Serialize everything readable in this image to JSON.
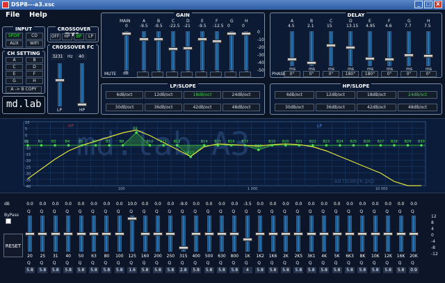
{
  "window": {
    "title": "DSP8---a3.xsc",
    "minimize": "_",
    "maximize": "□",
    "close": "X"
  },
  "menu": [
    {
      "label": "File"
    },
    {
      "label": "Help"
    }
  ],
  "input": {
    "title": "INPUT",
    "buttons": [
      {
        "label": "SPDIF",
        "active": true
      },
      {
        "label": "CD",
        "active": false
      },
      {
        "label": "AUX",
        "active": false
      },
      {
        "label": "WIFI",
        "active": false
      }
    ]
  },
  "ch_setting": {
    "title": "CH SETTING",
    "channels": [
      "A",
      "B",
      "C",
      "D",
      "E",
      "F",
      "G",
      "H"
    ],
    "copy": "A -> B COPY"
  },
  "brand": {
    "logo": "md.lab"
  },
  "crossover_type": {
    "title": "CROSSOVER TYPE",
    "buttons": [
      {
        "label": "OFF",
        "active": false
      },
      {
        "label": "HP",
        "active": false
      },
      {
        "label": "BP",
        "active": true
      },
      {
        "label": "LP",
        "active": false
      }
    ]
  },
  "crossover_fc": {
    "title": "CROSSOVER FC",
    "lp_value": "3231",
    "unit": "Hz",
    "hp_value": "40",
    "lp_label": "LP",
    "hp_label": "HP",
    "lp_level": 0.62,
    "hp_level": 0.05
  },
  "gain": {
    "title": "GAIN",
    "main_label": "MAIN",
    "main_value": "0",
    "main_level": 0.95,
    "channels": [
      {
        "name": "A",
        "value": "-9.5",
        "level": 0.8
      },
      {
        "name": "B",
        "value": "-9.5",
        "level": 0.8
      },
      {
        "name": "C",
        "value": "-22.5",
        "level": 0.55
      },
      {
        "name": "D",
        "value": "-21",
        "level": 0.58
      },
      {
        "name": "E",
        "value": "-9.5",
        "level": 0.8
      },
      {
        "name": "F",
        "value": "-12.5",
        "level": 0.75
      },
      {
        "name": "G",
        "value": "0",
        "level": 0.95
      },
      {
        "name": "H",
        "value": "0",
        "level": 0.95
      }
    ],
    "scale": [
      "0",
      "-10",
      "-20",
      "-30",
      "-40",
      "-50"
    ],
    "unit": "dB",
    "mute_label": "MUTE"
  },
  "delay": {
    "title": "DELAY",
    "channels": [
      {
        "name": "A",
        "value": "4.5",
        "unit": "ms",
        "phase": "0°",
        "level": 0.2
      },
      {
        "name": "B",
        "value": "2.1",
        "unit": "ms",
        "phase": "0°",
        "level": 0.1
      },
      {
        "name": "C",
        "value": "15",
        "unit": "ms",
        "phase": "0°",
        "level": 0.6
      },
      {
        "name": "D",
        "value": "13.15",
        "unit": "ms",
        "phase": "180°",
        "level": 0.55
      },
      {
        "name": "E",
        "value": "4.95",
        "unit": "ms",
        "phase": "180°",
        "level": 0.22
      },
      {
        "name": "F",
        "value": "4.6",
        "unit": "ms",
        "phase": "0°",
        "level": 0.2
      },
      {
        "name": "G",
        "value": "7.7",
        "unit": "ms",
        "phase": "0°",
        "level": 0.32
      },
      {
        "name": "H",
        "value": "7.5",
        "unit": "ms",
        "phase": "0°",
        "level": 0.31
      }
    ],
    "phase_label": "PHASE"
  },
  "lp_slope": {
    "title": "LP/SLOPE",
    "options": [
      {
        "label": "6dB/oct",
        "active": false
      },
      {
        "label": "12dB/oct",
        "active": false
      },
      {
        "label": "18dB/oct",
        "active": true
      },
      {
        "label": "24dB/oct",
        "active": false
      },
      {
        "label": "30dB/oct",
        "active": false
      },
      {
        "label": "36dB/oct",
        "active": false
      },
      {
        "label": "42dB/oct",
        "active": false
      },
      {
        "label": "48dB/oct",
        "active": false
      }
    ]
  },
  "hp_slope": {
    "title": "HP/SLOPE",
    "options": [
      {
        "label": "6dB/oct",
        "active": false
      },
      {
        "label": "12dB/oct",
        "active": false
      },
      {
        "label": "18dB/oct",
        "active": false
      },
      {
        "label": "24dB/oct",
        "active": true
      },
      {
        "label": "30dB/oct",
        "active": false
      },
      {
        "label": "36dB/oct",
        "active": false
      },
      {
        "label": "42dB/oct",
        "active": false
      },
      {
        "label": "48dB/oct",
        "active": false
      }
    ]
  },
  "eq_graph": {
    "hp_marker": "HP",
    "lp_marker": "LP",
    "x_ticks": [
      "100",
      "1 000",
      "10 000"
    ],
    "y_ticks": [
      "10",
      "5",
      "0",
      "-5",
      "-10",
      "-15",
      "-20",
      "-25",
      "-30",
      "-35",
      "-40"
    ],
    "watermark": "md.lab A3",
    "watermark_sub": "автозвук.рф",
    "bands": [
      {
        "name": "B1",
        "offset": 0
      },
      {
        "name": "B2",
        "offset": 0
      },
      {
        "name": "B3",
        "offset": 0
      },
      {
        "name": "B4",
        "offset": 0
      },
      {
        "name": "B5",
        "offset": 0
      },
      {
        "name": "B6",
        "offset": 0
      },
      {
        "name": "B7",
        "offset": 0
      },
      {
        "name": "B8",
        "offset": 0
      },
      {
        "name": "B9",
        "offset": 10
      },
      {
        "name": "B10",
        "offset": 0
      },
      {
        "name": "B11",
        "offset": 0
      },
      {
        "name": "B12",
        "offset": 0
      },
      {
        "name": "B13",
        "offset": -9
      },
      {
        "name": "B14",
        "offset": 0
      },
      {
        "name": "B15",
        "offset": 0
      },
      {
        "name": "B16",
        "offset": 0
      },
      {
        "name": "B17",
        "offset": 0
      },
      {
        "name": "B18",
        "offset": -3.5
      },
      {
        "name": "B19",
        "offset": 0
      },
      {
        "name": "B20",
        "offset": 0
      },
      {
        "name": "B21",
        "offset": 0
      },
      {
        "name": "B22",
        "offset": 0
      },
      {
        "name": "B23",
        "offset": 0
      },
      {
        "name": "B24",
        "offset": 0
      },
      {
        "name": "B25",
        "offset": 0
      },
      {
        "name": "B26",
        "offset": 0
      },
      {
        "name": "B27",
        "offset": 0
      },
      {
        "name": "B28",
        "offset": 0
      },
      {
        "name": "B29",
        "offset": 0
      },
      {
        "name": "B30",
        "offset": 0
      }
    ]
  },
  "eq_bank": {
    "db_label": "dB",
    "q_label": "Q",
    "bypass_label": "ByPass",
    "reset_label": "RESET",
    "scale": [
      "12",
      "8",
      "4",
      "0",
      "-4",
      "-8",
      "-12"
    ],
    "bands": [
      {
        "freq": "20",
        "gain": "0.0",
        "q": "5.8"
      },
      {
        "freq": "25",
        "gain": "0.0",
        "q": "5.8"
      },
      {
        "freq": "31",
        "gain": "0.0",
        "q": "5.8"
      },
      {
        "freq": "40",
        "gain": "0.0",
        "q": "5.8"
      },
      {
        "freq": "50",
        "gain": "0.0",
        "q": "5.8"
      },
      {
        "freq": "63",
        "gain": "0.0",
        "q": "5.8"
      },
      {
        "freq": "80",
        "gain": "0.0",
        "q": "5.8"
      },
      {
        "freq": "100",
        "gain": "0.0",
        "q": "5.8"
      },
      {
        "freq": "125",
        "gain": "10.0",
        "q": "1.6"
      },
      {
        "freq": "160",
        "gain": "0.0",
        "q": "5.8"
      },
      {
        "freq": "200",
        "gain": "0.0",
        "q": "5.8"
      },
      {
        "freq": "250",
        "gain": "0.0",
        "q": "5.8"
      },
      {
        "freq": "315",
        "gain": "-9.0",
        "q": "2.8"
      },
      {
        "freq": "400",
        "gain": "0.0",
        "q": "5.8"
      },
      {
        "freq": "500",
        "gain": "0.0",
        "q": "5.8"
      },
      {
        "freq": "630",
        "gain": "0.0",
        "q": "5.8"
      },
      {
        "freq": "800",
        "gain": "0.0",
        "q": "5.8"
      },
      {
        "freq": "1K",
        "gain": "-3.5",
        "q": "4"
      },
      {
        "freq": "1K2",
        "gain": "0.0",
        "q": "5.8"
      },
      {
        "freq": "1K6",
        "gain": "0.0",
        "q": "5.8"
      },
      {
        "freq": "2K",
        "gain": "0.0",
        "q": "5.8"
      },
      {
        "freq": "2K5",
        "gain": "0.0",
        "q": "5.8"
      },
      {
        "freq": "3K1",
        "gain": "0.0",
        "q": "5.8"
      },
      {
        "freq": "4K",
        "gain": "0.0",
        "q": "5.8"
      },
      {
        "freq": "5K",
        "gain": "0.0",
        "q": "5.8"
      },
      {
        "freq": "6K3",
        "gain": "0.0",
        "q": "5.8"
      },
      {
        "freq": "8K",
        "gain": "0.0",
        "q": "5.8"
      },
      {
        "freq": "10K",
        "gain": "0.0",
        "q": "5.8"
      },
      {
        "freq": "12K",
        "gain": "0.0",
        "q": "5.8"
      },
      {
        "freq": "16K",
        "gain": "0.0",
        "q": "5.8"
      },
      {
        "freq": "20K",
        "gain": "0.0",
        "q": "0.9"
      }
    ]
  }
}
